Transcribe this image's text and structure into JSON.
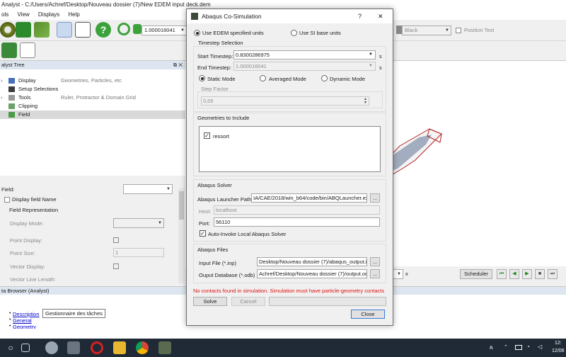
{
  "app": {
    "title": "Analyst - C:/Users/Achref/Desktop/Nouveau dossier (7)/New EDEM input deck.dem",
    "menu": [
      "ols",
      "View",
      "Displays",
      "Help"
    ],
    "timestep_value": "1.000016041",
    "color_combo": "Black",
    "position_text_label": "Position Text"
  },
  "tree": {
    "header": "alyst Tree",
    "items": [
      {
        "label": "Display",
        "desc": "Geometries, Particles, etc"
      },
      {
        "label": "Setup Selections",
        "desc": ""
      },
      {
        "label": "Tools",
        "desc": "Ruler, Protractor & Domain Grid"
      },
      {
        "label": "Clipping",
        "desc": ""
      },
      {
        "label": "Field",
        "desc": ""
      }
    ]
  },
  "field_panel": {
    "field_label": "Field:",
    "display_field_name": "Display field Name",
    "field_representation": "Field Representation",
    "display_mode": "Display Mode:",
    "point_display": "Point Display:",
    "point_size": "Point Size:",
    "point_size_value": "1",
    "vector_display": "Vector Display:",
    "vector_line_length": "Vector Line Length:"
  },
  "bottombar": {
    "scheduler": "Scheduler",
    "close_x": "x"
  },
  "data_browser": {
    "header": "ta Browser (Analyst)",
    "links": [
      "Description",
      "General",
      "Geometry"
    ],
    "tooltip": "Gestionnaire des tâches"
  },
  "taskbar": {
    "time": "12:",
    "date": "12/06"
  },
  "dialog": {
    "title": "Abaqus Co-Simulation",
    "help": "?",
    "close": "✕",
    "units": {
      "edem": "Use EDEM specified units",
      "si": "Use SI base units",
      "selected": "edem"
    },
    "timestep_selection": {
      "header": "Timestep Selection",
      "start_label": "Start Timestep:",
      "start_value": "0.8300286975",
      "end_label": "End Timestep:",
      "end_value": "1.000016041",
      "unit": "s",
      "modes": [
        "Static Mode",
        "Averaged Mode",
        "Dynamic Mode"
      ],
      "selected_mode": "Static Mode",
      "step_factor_label": "Step Factor",
      "step_factor_value": "0,05"
    },
    "geometries": {
      "header": "Geometries to Include",
      "items": [
        {
          "label": "ressort",
          "checked": true
        }
      ]
    },
    "solver": {
      "header": "Abaqus Solver",
      "launcher_label": "Abaqus Launcher Path",
      "launcher_value": "IA/CAE/2018/win_b64/code/bin/ABQLauncher.exe",
      "host_label": "Host:",
      "host_value": "localhost",
      "port_label": "Port:",
      "port_value": "56110",
      "auto_invoke": "Auto-Invoke Local Abaqus Solver",
      "browse": "..."
    },
    "files": {
      "header": "Abaqus Files",
      "input_label": "Input File (*.inp)",
      "input_value": "Desktop/Nouveau dossier (7)/abaqus_output.inp",
      "output_label": "Ouput Database (*.odb)",
      "output_value": "Achref/Desktop/Nouveau dossier (7)/output.odb",
      "browse": "..."
    },
    "warning": "No contacts found in simulation. Simulation must have particle-geometry contacts",
    "solve": "Solve",
    "cancel": "Cancel",
    "close_button": "Close"
  },
  "colors": {
    "warning": "#e01010",
    "geometry_edge": "#b02020",
    "geometry_fill": "#7f8fa8"
  }
}
